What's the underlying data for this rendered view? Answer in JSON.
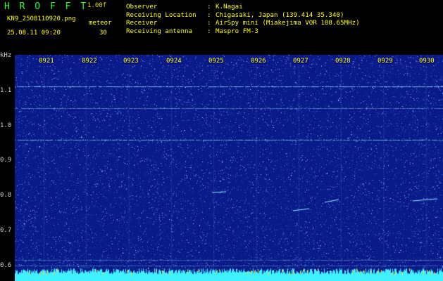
{
  "header": {
    "brand": "H R O F F T",
    "version": "1.00f",
    "filename": "KN9_2508110920.png",
    "mode": "meteor",
    "datetime": "25.08.11 09:20",
    "interval": "30",
    "info": [
      {
        "key": "Observer",
        "value": "K.Nagai"
      },
      {
        "key": "Receiving Location",
        "value": "Chigasaki, Japan (139.414 35.340)"
      },
      {
        "key": "Receiver",
        "value": "AirSpy mini (Miakejima VOR 108.65MHz)"
      },
      {
        "key": "Receiving antenna",
        "value": "Maspro FM-3"
      }
    ]
  },
  "spectrogram": {
    "unit": "kHz",
    "y_ticks": [
      "1.1",
      "1.0",
      "0.9",
      "0.8",
      "0.7",
      "0.6"
    ],
    "time_ticks": [
      "0921",
      "0922",
      "0923",
      "0924",
      "0925",
      "0926",
      "0927",
      "0928",
      "0929",
      "0930"
    ],
    "colors": {
      "background": "#0a1a88",
      "noise": "#5a8fff",
      "carrier": "#8ff2ff",
      "baseline": "#3ff0ff",
      "text": "#ffff00"
    }
  }
}
